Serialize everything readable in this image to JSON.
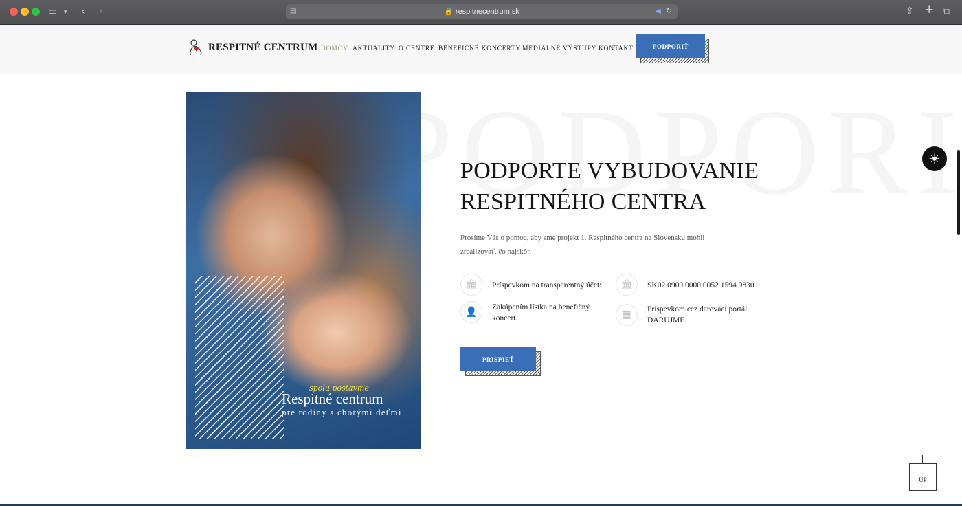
{
  "browser": {
    "url": "respitnecentrum.sk",
    "traffic_colors": [
      "#ff5f57",
      "#febc2e",
      "#28c840"
    ]
  },
  "header": {
    "logo_text": "RESPITNÉ CENTRUM",
    "nav": [
      "DOMOV",
      "AKTUALITY",
      "O CENTRE",
      "BENEFIČNÉ KONCERTY",
      "MEDIÁLNE VÝSTUPY",
      "KONTAKT"
    ],
    "support_label": "PODPORIŤ"
  },
  "hero": {
    "watermark": "PODPORI",
    "title_line1": "PODPORTE VYBUDOVANIE",
    "title_line2": "RESPITNÉHO CENTRA",
    "intro": "Prosíme Vás o pomoc, aby sme projekt 1. Respitného centra na Slovensku mohli zrealizovať, čo najskôr.",
    "image": {
      "script": "spolu postavme",
      "title": "Respitné centrum",
      "subtitle": "pre rodiny s chorými deťmi"
    },
    "items": [
      {
        "icon": "bank-icon",
        "text": "Príspevkom na transparentný účet:"
      },
      {
        "icon": "bank-icon",
        "text": "SK02 0900 0000 0052 1594 9830"
      },
      {
        "icon": "user-ticket-icon",
        "text": "Zakúpením lístka na benefičný koncert."
      },
      {
        "icon": "gift-portal-icon",
        "text": "Príspevkom cez darovací portál DARUJME."
      }
    ],
    "contribute_label": "PRISPIEŤ"
  },
  "widgets": {
    "up_label": "UP"
  },
  "colors": {
    "accent": "#3a6eb7",
    "nav_active": "#a89d7c",
    "footer": "#1d3f4e"
  }
}
